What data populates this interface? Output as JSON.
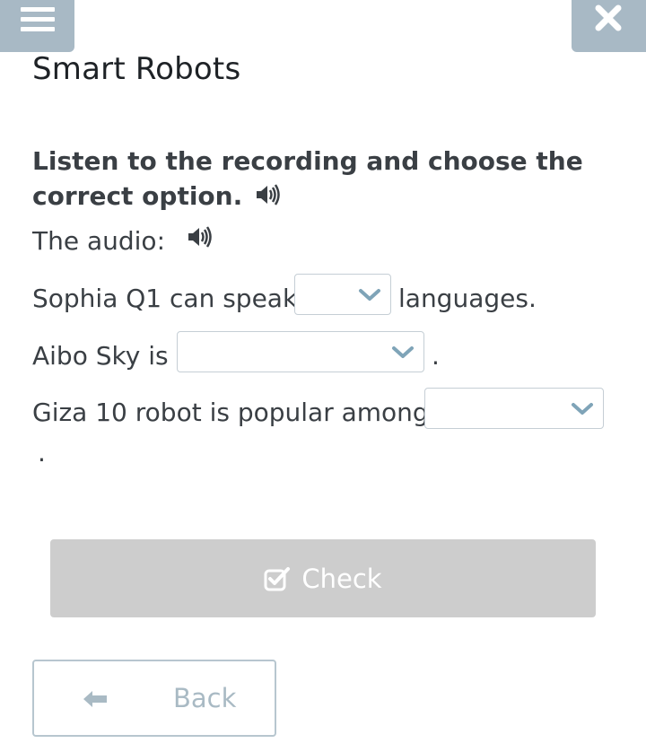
{
  "header": {
    "title": "Smart Robots",
    "menu_icon": "hamburger-menu-icon",
    "close_icon": "close-x-icon"
  },
  "task": {
    "instruction": "Listen to the recording and choose the correct option.",
    "audio_label": "The audio:"
  },
  "questions": [
    {
      "before": "Sophia Q1 can speak",
      "after": "languages.",
      "selected": ""
    },
    {
      "before": "Aibo Sky is",
      "after": ".",
      "selected": ""
    },
    {
      "before": "Giza 10 robot is popular among",
      "after": ".",
      "selected": ""
    }
  ],
  "buttons": {
    "check_label": "Check",
    "back_label": "Back"
  },
  "colors": {
    "top_button_bg": "#a8b9c5",
    "dropdown_chevron": "#7fa4b8",
    "check_button_bg": "#cdcdcd",
    "back_border": "#b7c6cf"
  }
}
